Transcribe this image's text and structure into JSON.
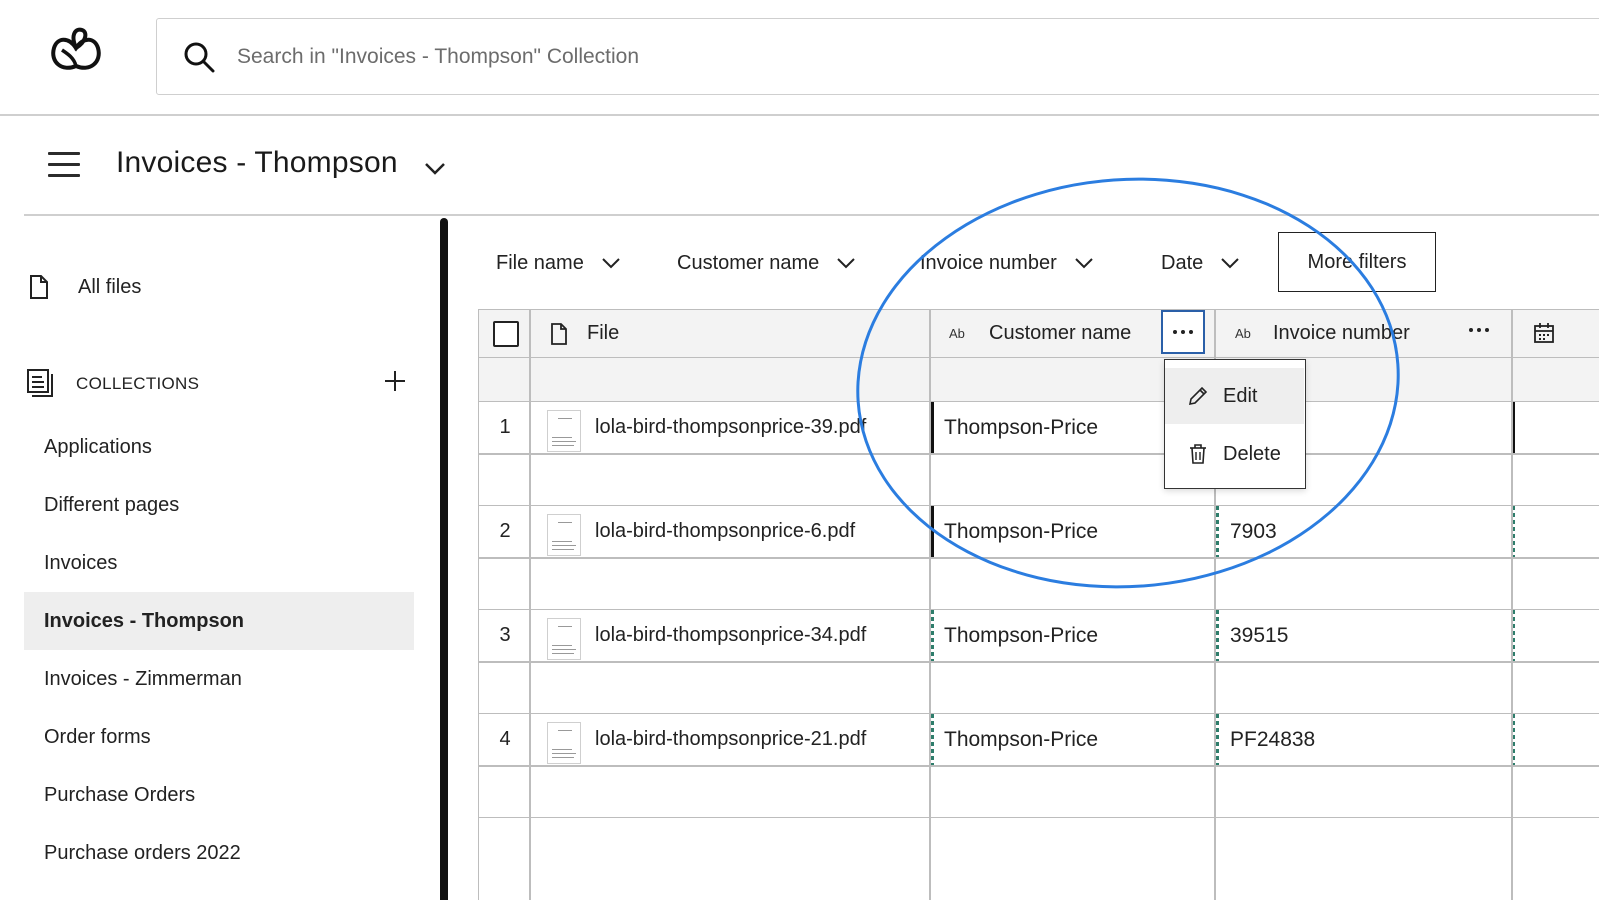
{
  "search": {
    "placeholder": "Search in \"Invoices - Thompson\" Collection"
  },
  "header": {
    "title": "Invoices - Thompson"
  },
  "sidebar": {
    "all_files": "All files",
    "collections_label": "COLLECTIONS",
    "items": [
      {
        "label": "Applications"
      },
      {
        "label": "Different pages"
      },
      {
        "label": "Invoices"
      },
      {
        "label": "Invoices - Thompson",
        "active": true
      },
      {
        "label": "Invoices - Zimmerman"
      },
      {
        "label": "Order forms"
      },
      {
        "label": "Purchase Orders"
      },
      {
        "label": "Purchase orders 2022"
      }
    ]
  },
  "filters": {
    "file_name": "File name",
    "customer_name": "Customer name",
    "invoice_number": "Invoice number",
    "date": "Date",
    "more": "More filters"
  },
  "table": {
    "columns": {
      "file": "File",
      "customer_type": "Ab",
      "customer": "Customer name",
      "invoice_type": "Ab",
      "invoice": "Invoice number"
    },
    "rows": [
      {
        "num": "1",
        "file": "lola-bird-thompsonprice-39.pdf",
        "customer": "Thompson-Price",
        "invoice": ""
      },
      {
        "num": "2",
        "file": "lola-bird-thompsonprice-6.pdf",
        "customer": "Thompson-Price",
        "invoice": "7903"
      },
      {
        "num": "3",
        "file": "lola-bird-thompsonprice-34.pdf",
        "customer": "Thompson-Price",
        "invoice": "39515"
      },
      {
        "num": "4",
        "file": "lola-bird-thompsonprice-21.pdf",
        "customer": "Thompson-Price",
        "invoice": "PF24838"
      }
    ]
  },
  "context_menu": {
    "edit": "Edit",
    "delete": "Delete"
  },
  "colors": {
    "annotation": "#2b7de0",
    "active_button_border": "#2a5fa8",
    "dashed_marker": "#2e7d6b"
  },
  "icons": [
    "app-logo-icon",
    "search-icon",
    "hamburger-icon",
    "chevron-down-icon",
    "file-icon",
    "collections-icon",
    "plus-icon",
    "calendar-icon",
    "more-dots-icon",
    "pencil-icon",
    "trash-icon"
  ]
}
